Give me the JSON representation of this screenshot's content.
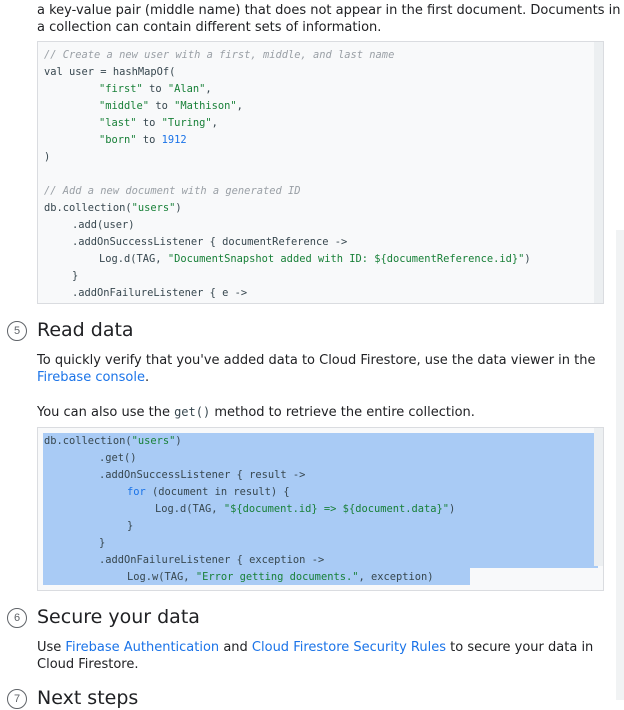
{
  "intro": {
    "line1": "a key-value pair (middle name) that does not appear in the first document. Documents in",
    "line2": "a collection can contain different sets of information."
  },
  "code1": {
    "comment1": "// Create a new user with a first, middle, and last name",
    "l2": "val user = hashMapOf(",
    "first_key": "\"first\"",
    "first_val": "\"Alan\"",
    "middle_key": "\"middle\"",
    "middle_val": "\"Mathison\"",
    "last_key": "\"last\"",
    "last_val": "\"Turing\"",
    "born_key": "\"born\"",
    "born_val": "1912",
    "op_to": "to",
    "comma": ",",
    "close_paren": ")",
    "comment2": "// Add a new document with a generated ID",
    "db_prefix": "db.collection(",
    "db_arg": "\"users\"",
    "db_suffix": ")",
    "add": ".add(user)",
    "success": ".addOnSuccessListener { documentReference ->",
    "log_prefix": "Log.d(TAG, ",
    "log_str": "\"DocumentSnapshot added with ID: ${documentReference.id}\"",
    "log_suffix": ")",
    "close_brace": "}",
    "failure": ".addOnFailureListener { e ->"
  },
  "step5": {
    "number": "5",
    "title": "Read data",
    "p1_line1": "To quickly verify that you've added data to Cloud Firestore, use the data viewer in the",
    "p1_link": "Firebase console",
    "p1_end": ".",
    "p2_before": "You can also use the ",
    "p2_code": "get()",
    "p2_after": " method to retrieve the entire collection."
  },
  "code2": {
    "db_prefix": "db.collection(",
    "db_arg": "\"users\"",
    "db_suffix": ")",
    "get": ".get()",
    "success": ".addOnSuccessListener { result ->",
    "for_kw": "for",
    "for_rest": " (document in result) {",
    "log_prefix": "Log.d(TAG, ",
    "log_str": "\"${document.id} => ${document.data}\"",
    "log_suffix": ")",
    "close_brace": "}",
    "failure": ".addOnFailureListener { exception ->",
    "logw_prefix": "Log.w(TAG, ",
    "logw_str": "\"Error getting documents.\"",
    "logw_suffix": ", exception)"
  },
  "step6": {
    "number": "6",
    "title": "Secure your data",
    "p_use": "Use ",
    "p_link1": "Firebase Authentication",
    "p_and": " and ",
    "p_link2": "Cloud Firestore Security Rules",
    "p_rest": " to secure your data in",
    "p_line2": "Cloud Firestore."
  },
  "step7": {
    "number": "7",
    "title": "Next steps"
  }
}
